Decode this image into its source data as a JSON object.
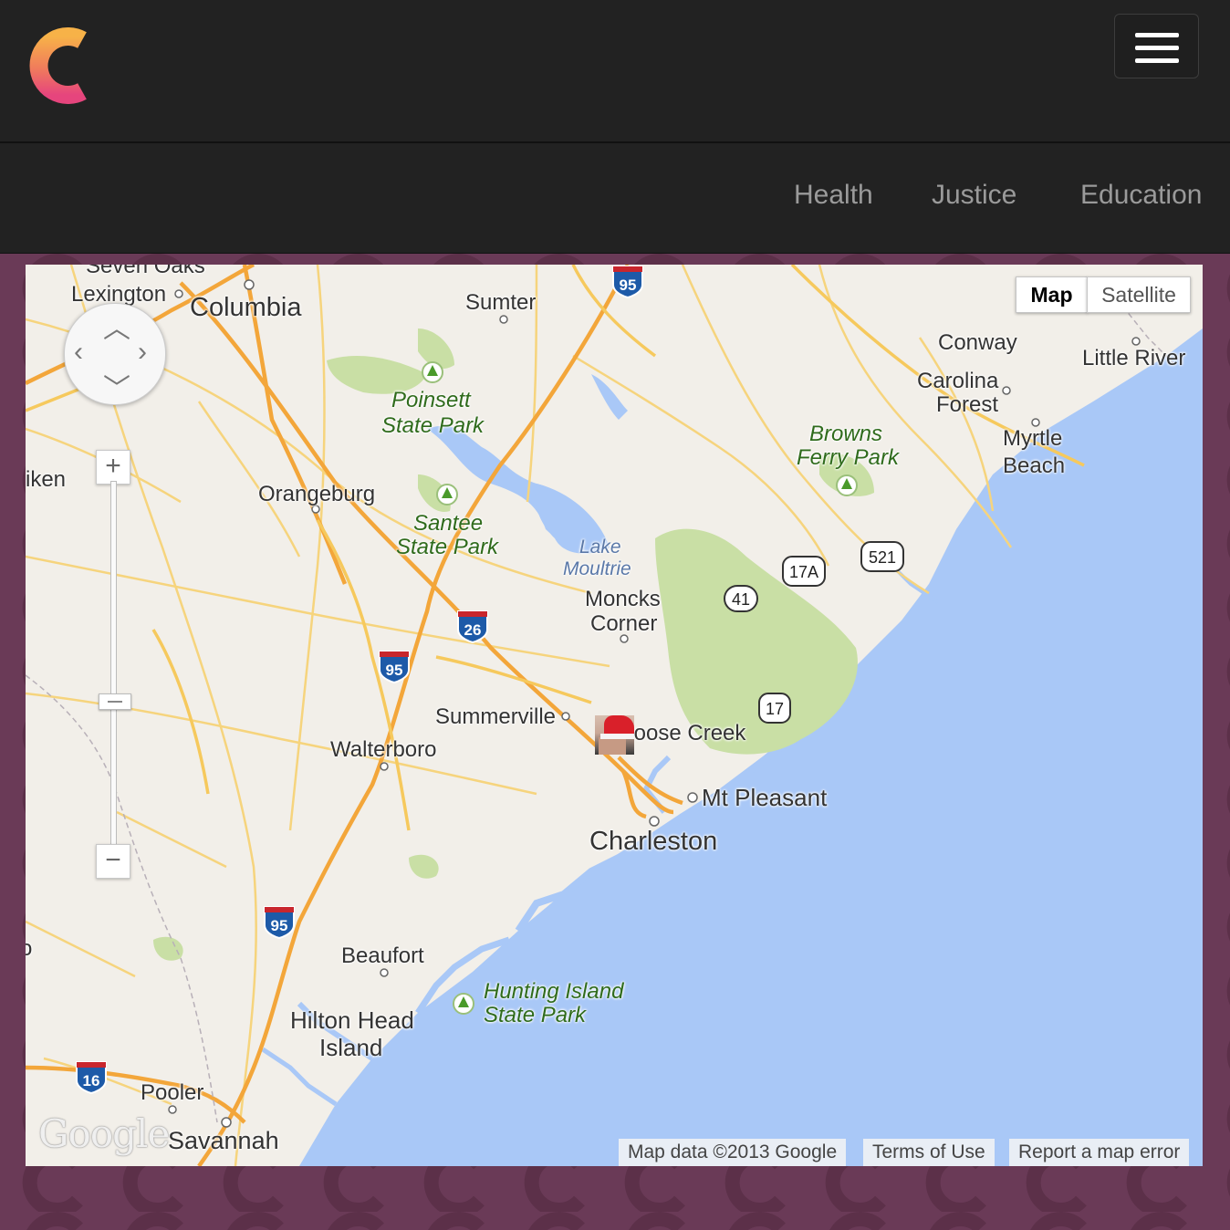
{
  "header": {
    "logo_icon": "c-logo-icon",
    "menu_icon": "hamburger-menu-icon"
  },
  "nav": {
    "links": [
      "Health",
      "Justice",
      "Education"
    ]
  },
  "map": {
    "type_controls": {
      "map": "Map",
      "satellite": "Satellite",
      "selected": "Map"
    },
    "zoom_in": "+",
    "zoom_out": "−",
    "cities": {
      "seven_oaks": "Seven Oaks",
      "lexington": "Lexington",
      "columbia": "Columbia",
      "sumter": "Sumter",
      "conway": "Conway",
      "little_river": "Little River",
      "carolina_forest_1": "Carolina",
      "carolina_forest_2": "Forest",
      "myrtle_1": "Myrtle",
      "myrtle_2": "Beach",
      "aiken": "iken",
      "orangeburg": "Orangeburg",
      "moncks_1": "Moncks",
      "moncks_2": "Corner",
      "summerville": "Summerville",
      "goose_creek": "Goose Creek",
      "walterboro": "Walterboro",
      "mt_pleasant": "Mt Pleasant",
      "charleston": "Charleston",
      "beaufort": "Beaufort",
      "hilton_1": "Hilton Head",
      "hilton_2": "Island",
      "pooler": "Pooler",
      "savannah": "Savannah",
      "edge_o": "o"
    },
    "parks": {
      "poinsett_1": "Poinsett",
      "poinsett_2": "State Park",
      "santee_1": "Santee",
      "santee_2": "State Park",
      "browns_1": "Browns",
      "browns_2": "Ferry Park",
      "hunting_1": "Hunting Island",
      "hunting_2": "State Park"
    },
    "water": {
      "lake_1": "Lake",
      "lake_2": "Moultrie"
    },
    "shields": {
      "i95_top": "95",
      "i95_mid": "95",
      "i95_low": "95",
      "i26": "26",
      "i16": "16",
      "us17a": "17A",
      "us521": "521",
      "us17": "17",
      "sc41": "41"
    },
    "attribution": {
      "logo": "Google",
      "data": "Map data ©2013 Google",
      "terms": "Terms of Use",
      "report": "Report a map error"
    },
    "colors": {
      "land": "#f2efe9",
      "water": "#a9c8f7",
      "park": "#c9dfa5",
      "highway": "#f3a63a",
      "road": "#f6c95d"
    }
  }
}
